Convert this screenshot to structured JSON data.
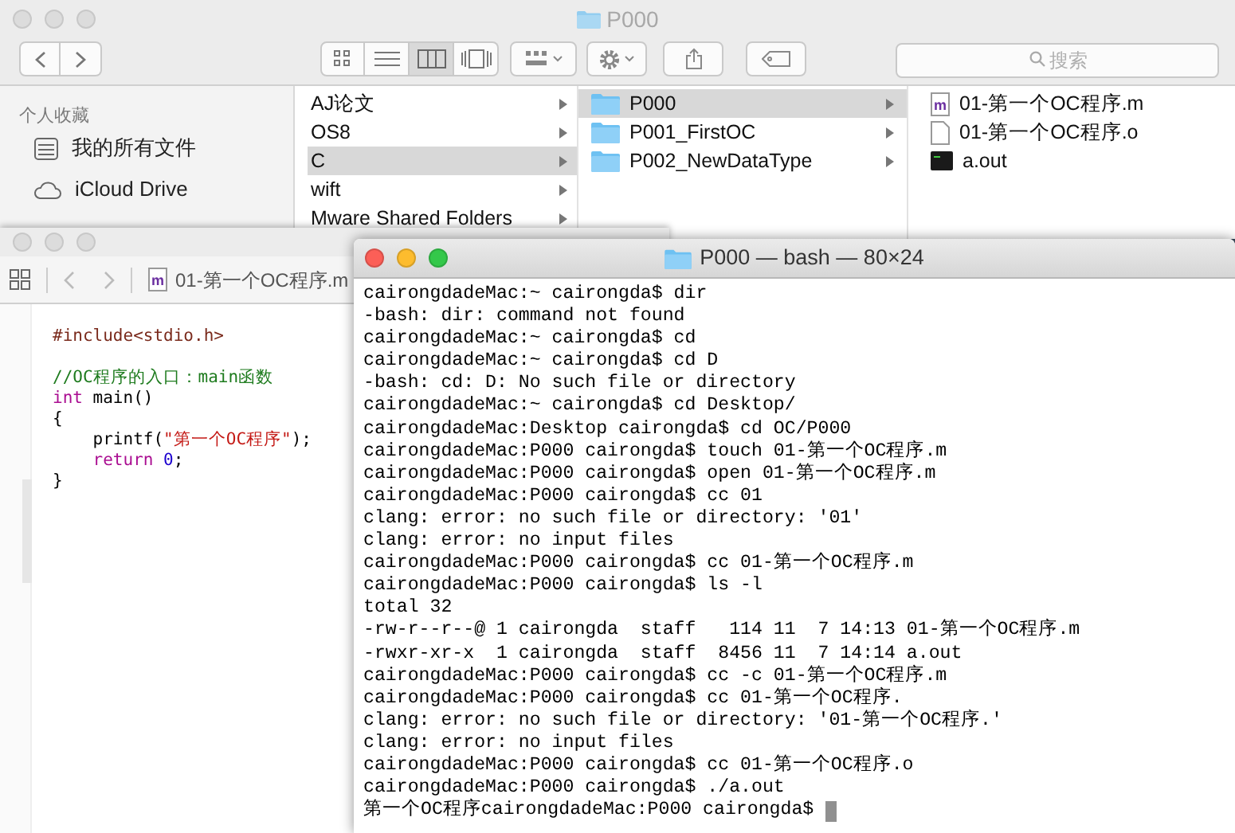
{
  "finder": {
    "title": "P000",
    "view_modes": [
      {
        "kind": "icons",
        "selected": false
      },
      {
        "kind": "list",
        "selected": false
      },
      {
        "kind": "columns",
        "selected": true
      },
      {
        "kind": "coverflow",
        "selected": false
      }
    ],
    "search": {
      "placeholder": "搜索"
    },
    "sidebar": {
      "header": "个人收藏",
      "items": [
        {
          "label": "我的所有文件",
          "kind": "files"
        },
        {
          "label": "iCloud Drive",
          "kind": "cloud"
        }
      ]
    },
    "columns": [
      [
        {
          "label": "AJ论文",
          "selected": false,
          "arrow": true
        },
        {
          "label": "OS8",
          "selected": false,
          "arrow": true
        },
        {
          "label": "C",
          "selected": true,
          "arrow": true
        },
        {
          "label": "wift",
          "selected": false,
          "arrow": true
        },
        {
          "label": "Mware Shared Folders",
          "selected": false,
          "arrow": true
        }
      ],
      [
        {
          "label": "P000",
          "kind": "folder",
          "selected": true,
          "arrow": true
        },
        {
          "label": "P001_FirstOC",
          "kind": "folder",
          "selected": false,
          "arrow": true
        },
        {
          "label": "P002_NewDataType",
          "kind": "folder",
          "selected": false,
          "arrow": true
        }
      ],
      [
        {
          "label": "01-第一个OC程序.m",
          "kind": "source",
          "icon_letter": "m",
          "selected": false,
          "arrow": false
        },
        {
          "label": "01-第一个OC程序.o",
          "kind": "document",
          "selected": false,
          "arrow": false
        },
        {
          "label": "a.out",
          "kind": "executable",
          "selected": false,
          "arrow": false
        }
      ]
    ]
  },
  "editor": {
    "jump_icon_letter": "m",
    "jump_file": "01-第一个OC程序.m",
    "code": [
      {
        "kind": "code",
        "tokens": [
          {
            "kind": "preproc",
            "text": "#include<stdio.h>"
          }
        ]
      },
      {
        "kind": "blank"
      },
      {
        "kind": "code",
        "tokens": [
          {
            "kind": "comment",
            "text": "//OC程序的入口：main函数"
          }
        ]
      },
      {
        "kind": "code",
        "tokens": [
          {
            "kind": "keyword",
            "text": "int"
          },
          {
            "kind": "plain",
            "text": " main()"
          }
        ]
      },
      {
        "kind": "code",
        "tokens": [
          {
            "kind": "plain",
            "text": "{"
          }
        ]
      },
      {
        "kind": "code",
        "tokens": [
          {
            "kind": "plain",
            "text": "    printf("
          },
          {
            "kind": "string",
            "text": "\"第一个OC程序\""
          },
          {
            "kind": "plain",
            "text": ");"
          }
        ]
      },
      {
        "kind": "code",
        "tokens": [
          {
            "kind": "keyword",
            "text": "    return"
          },
          {
            "kind": "number",
            "text": " 0"
          },
          {
            "kind": "plain",
            "text": ";"
          }
        ]
      },
      {
        "kind": "code",
        "tokens": [
          {
            "kind": "plain",
            "text": "}"
          }
        ]
      }
    ]
  },
  "terminal": {
    "title": "P000 — bash — 80×24",
    "cursor": true,
    "lines": [
      "cairongdadeMac:~ cairongda$ dir",
      "-bash: dir: command not found",
      "cairongdadeMac:~ cairongda$ cd",
      "cairongdadeMac:~ cairongda$ cd D",
      "-bash: cd: D: No such file or directory",
      "cairongdadeMac:~ cairongda$ cd Desktop/",
      "cairongdadeMac:Desktop cairongda$ cd OC/P000",
      "cairongdadeMac:P000 cairongda$ touch 01-第一个OC程序.m",
      "cairongdadeMac:P000 cairongda$ open 01-第一个OC程序.m",
      "cairongdadeMac:P000 cairongda$ cc 01",
      "clang: error: no such file or directory: '01'",
      "clang: error: no input files",
      "cairongdadeMac:P000 cairongda$ cc 01-第一个OC程序.m",
      "cairongdadeMac:P000 cairongda$ ls -l",
      "total 32",
      "-rw-r--r--@ 1 cairongda  staff   114 11  7 14:13 01-第一个OC程序.m",
      "-rwxr-xr-x  1 cairongda  staff  8456 11  7 14:14 a.out",
      "cairongdadeMac:P000 cairongda$ cc -c 01-第一个OC程序.m",
      "cairongdadeMac:P000 cairongda$ cc 01-第一个OC程序.",
      "clang: error: no such file or directory: '01-第一个OC程序.'",
      "clang: error: no input files",
      "cairongdadeMac:P000 cairongda$ cc 01-第一个OC程序.o",
      "cairongdadeMac:P000 cairongda$ ./a.out",
      "第一个OC程序cairongdadeMac:P000 cairongda$"
    ]
  }
}
